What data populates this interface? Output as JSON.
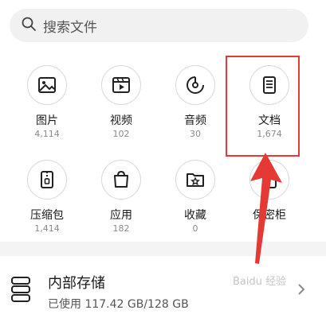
{
  "search": {
    "placeholder": "搜索文件"
  },
  "categories": [
    {
      "label": "图片",
      "count": "4,114",
      "icon": "image-icon"
    },
    {
      "label": "视频",
      "count": "102",
      "icon": "video-icon"
    },
    {
      "label": "音频",
      "count": "30",
      "icon": "audio-icon"
    },
    {
      "label": "文档",
      "count": "1,674",
      "icon": "document-icon"
    },
    {
      "label": "压缩包",
      "count": "1,414",
      "icon": "archive-icon"
    },
    {
      "label": "应用",
      "count": "182",
      "icon": "app-icon"
    },
    {
      "label": "收藏",
      "count": "0",
      "icon": "favorite-icon"
    },
    {
      "label": "保密柜",
      "count": "",
      "icon": "safe-icon"
    }
  ],
  "storage": {
    "title": "内部存储",
    "usage": "已使用 117.42 GB/128 GB"
  },
  "watermark": "Baidu 经验",
  "colors": {
    "annotation": "#e53935",
    "accent": "#222222"
  }
}
